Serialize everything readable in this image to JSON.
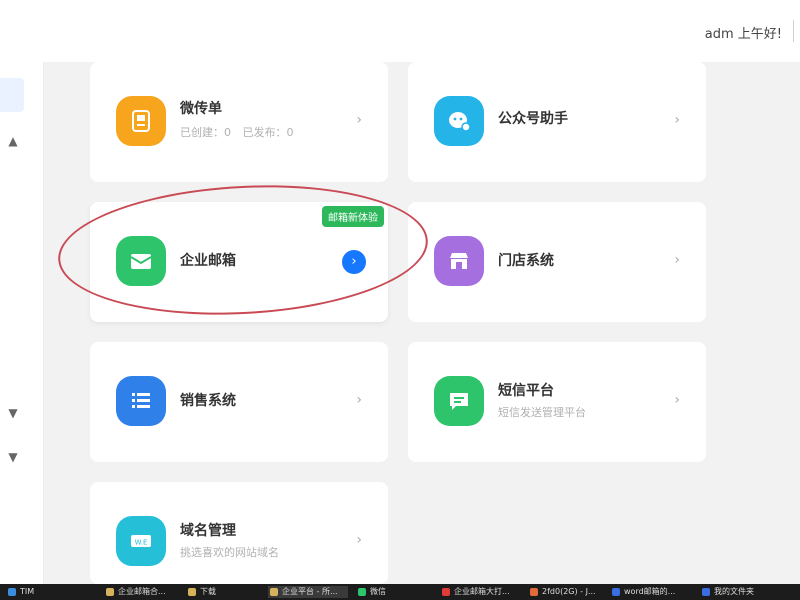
{
  "header": {
    "greeting": "adm 上午好!"
  },
  "cards": [
    {
      "title": "微传单",
      "stats": [
        "已创建：0",
        "已发布：0"
      ]
    },
    {
      "title": "公众号助手"
    },
    {
      "title": "企业邮箱",
      "badge": "邮箱新体验"
    },
    {
      "title": "门店系统"
    },
    {
      "title": "销售系统"
    },
    {
      "title": "短信平台",
      "subtitle": "短信发送管理平台"
    },
    {
      "title": "域名管理",
      "subtitle": "挑选喜欢的网站域名"
    }
  ],
  "taskbar": {
    "items": [
      "TIM",
      "企业邮箱合...",
      "下载",
      "企业平台 - 所...",
      "微信",
      "企业邮箱大打...",
      "2fd0(2G) - J...",
      "word邮箱的...",
      "我的文件夹"
    ]
  },
  "colors": {
    "accent": "#1677ff",
    "badge": "#2eb85c",
    "annotation": "#c94a55"
  },
  "icons": {
    "card_icons": [
      "flyer-icon",
      "chat-bubble-icon",
      "mail-icon",
      "store-icon",
      "list-icon",
      "message-icon",
      "domain-icon"
    ]
  }
}
